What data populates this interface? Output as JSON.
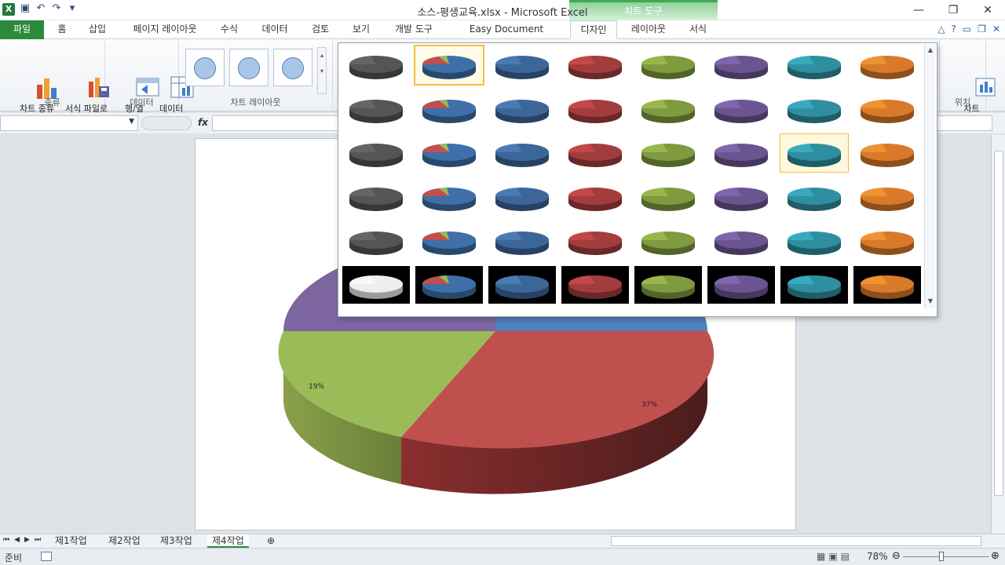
{
  "app": {
    "title": "소스-평생교육.xlsx - Microsoft Excel",
    "context_group": "차트 도구",
    "logo": "X"
  },
  "tabs": [
    {
      "label": "파일"
    },
    {
      "label": "홈"
    },
    {
      "label": "삽입"
    },
    {
      "label": "페이지 레이아웃"
    },
    {
      "label": "수식"
    },
    {
      "label": "데이터"
    },
    {
      "label": "검토"
    },
    {
      "label": "보기"
    },
    {
      "label": "개발 도구"
    },
    {
      "label": "Easy Document Creator"
    },
    {
      "label": "디자인"
    },
    {
      "label": "레이아웃"
    },
    {
      "label": "서식"
    }
  ],
  "ribbon": {
    "groups": {
      "type": "종류",
      "data": "데이터",
      "layouts": "차트 레이아웃",
      "location": "위치"
    },
    "buttons": {
      "change_type": "차트 종류\n변경",
      "save_template": "서식 파일로\n저장",
      "switch_row_col": "행/열\n전환",
      "select_data": "데이터\n선택",
      "move_chart": "차트\n이동"
    }
  },
  "formula": {
    "fx": "fx"
  },
  "chart": {
    "labels": {
      "green": "19%",
      "red": "37%"
    }
  },
  "gallery": {
    "palettes": [
      {
        "name": "gray",
        "color": "#555555"
      },
      {
        "name": "multi",
        "color": "#3f6fa8"
      },
      {
        "name": "blue",
        "color": "#3d6698"
      },
      {
        "name": "red",
        "color": "#a33d3d"
      },
      {
        "name": "green",
        "color": "#7f9a3f"
      },
      {
        "name": "purple",
        "color": "#6b5590"
      },
      {
        "name": "teal",
        "color": "#2f8fa0"
      },
      {
        "name": "orange",
        "color": "#d97a2a"
      }
    ],
    "rows": 6,
    "selected": {
      "row": 0,
      "col": 1
    },
    "hover": {
      "row": 2,
      "col": 6
    }
  },
  "sheets": [
    {
      "label": "제1작업"
    },
    {
      "label": "제2작업"
    },
    {
      "label": "제3작업"
    },
    {
      "label": "제4작업"
    }
  ],
  "status": {
    "ready": "준비",
    "zoom": "78%"
  }
}
